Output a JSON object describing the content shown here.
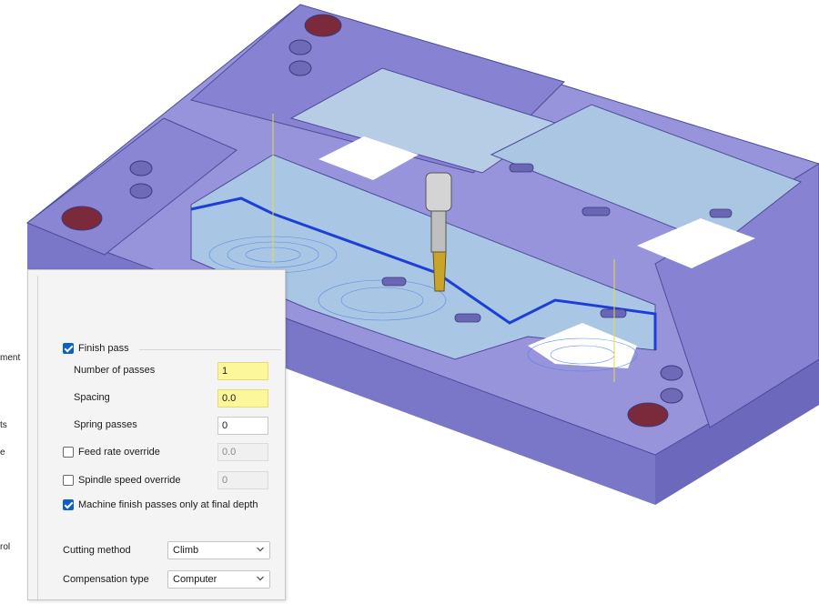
{
  "side_labels": [
    "ment",
    "ts",
    "e",
    "rol"
  ],
  "finish_pass": {
    "label": "Finish pass",
    "checked": true,
    "number_of_passes": {
      "label": "Number of passes",
      "value": "1"
    },
    "spacing": {
      "label": "Spacing",
      "value": "0.0"
    },
    "spring_passes": {
      "label": "Spring passes",
      "value": "0"
    },
    "feed_rate_override": {
      "label": "Feed rate override",
      "checked": false,
      "value": "0.0"
    },
    "spindle_speed_override": {
      "label": "Spindle speed override",
      "checked": false,
      "value": "0"
    },
    "machine_finish_only_final_depth": {
      "label": "Machine finish passes only at final depth",
      "checked": true
    }
  },
  "cutting_method": {
    "label": "Cutting method",
    "value": "Climb"
  },
  "compensation_type": {
    "label": "Compensation type",
    "value": "Computer"
  },
  "colors": {
    "model_fill": "#8c88d6",
    "model_dark": "#5d59a8",
    "toolpath_blue": "#1d3fd6",
    "checkbox_blue": "#0a62c9",
    "highlight_field": "#fbf79a"
  },
  "icons": [
    "checkmark-icon",
    "chevron-down-icon",
    "end-mill-tool-icon"
  ]
}
